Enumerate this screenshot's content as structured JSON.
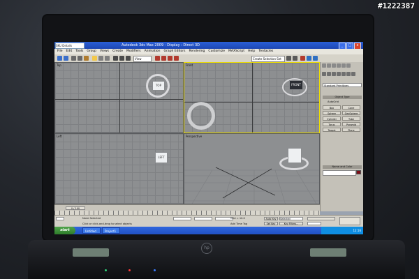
{
  "watermark": "#1222387",
  "window": {
    "title": "Autodesk 3ds Max 2009  - Display : Direct 3D",
    "address": "SKU Details",
    "controls": [
      "_",
      "□",
      "x"
    ]
  },
  "menubar": {
    "items": [
      "File",
      "Edit",
      "Tools",
      "Group",
      "Views",
      "Create",
      "Modifiers",
      "Animation",
      "Graph Editors",
      "Rendering",
      "Customize",
      "MAXScript",
      "Help",
      "Tentacles"
    ]
  },
  "toolbar": {
    "view_select": "View",
    "selection_set": "Create Selection Set"
  },
  "viewports": {
    "top": "Top",
    "front": "Front",
    "left": "Left",
    "perspective": "Perspective",
    "cube_top": "TOP",
    "cube_front": "FRONT",
    "cube_left": "LEFT"
  },
  "command_panel": {
    "category": "Standard Primitives",
    "object_type_label": "Object Type",
    "autogrid": "AutoGrid",
    "objects": [
      "Box",
      "Cone",
      "Sphere",
      "GeoSphere",
      "Cylinder",
      "Tube",
      "Torus",
      "Pyramid",
      "Teapot",
      "Plane"
    ],
    "name_color_label": "Name and Color",
    "color": "#7a0d16"
  },
  "timeline": {
    "slider": "0 / 100"
  },
  "status": {
    "selection": "None Selected",
    "prompt": "Click or click-and-drag to select objects",
    "grid": "Grid = 10.0",
    "add_time_tag": "Add Time Tag",
    "auto_key": "Auto Key",
    "set_key": "Set Key",
    "key_mode": "Selected",
    "key_filters": "Key Filters..."
  },
  "taskbar": {
    "start": "start",
    "items": [
      "Untitled",
      "Project1"
    ],
    "clock": "12:16"
  }
}
